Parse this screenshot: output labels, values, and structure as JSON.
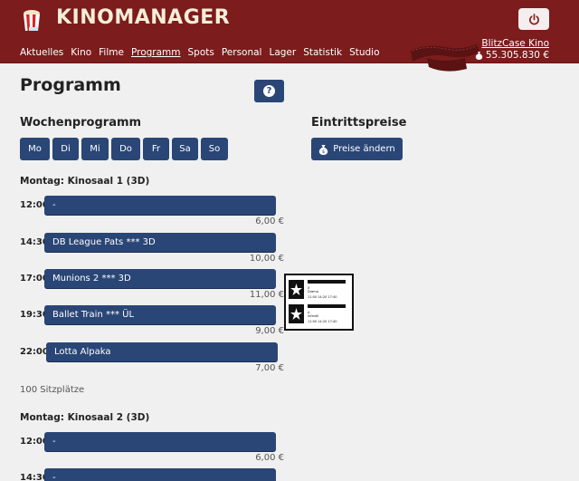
{
  "header": {
    "brand": "KINOMANAGER",
    "logo_icon": "popcorn-icon",
    "nav": [
      {
        "label": "Aktuelles",
        "active": false
      },
      {
        "label": "Kino",
        "active": false
      },
      {
        "label": "Filme",
        "active": false
      },
      {
        "label": "Programm",
        "active": true
      },
      {
        "label": "Spots",
        "active": false
      },
      {
        "label": "Personal",
        "active": false
      },
      {
        "label": "Lager",
        "active": false
      },
      {
        "label": "Statistik",
        "active": false
      },
      {
        "label": "Studio",
        "active": false
      }
    ],
    "power_icon": "power-icon",
    "account_name": "BlitzCase Kino",
    "balance": "55.305.830 €",
    "balance_icon": "money-bag-icon"
  },
  "colors": {
    "header_bg": "#7c1c1c",
    "button_bg": "#2a4676",
    "page_bg": "#f0f0f0"
  },
  "main": {
    "title": "Programm",
    "help_label": "?",
    "week_section": {
      "title": "Wochenprogramm",
      "days": [
        "Mo",
        "Di",
        "Mi",
        "Do",
        "Fr",
        "Sa",
        "So"
      ]
    },
    "prices_section": {
      "title": "Eintrittspreise",
      "button_label": "Preise ändern"
    },
    "halls": [
      {
        "title": "Montag: Kinosaal 1 (3D)",
        "slots": [
          {
            "time": "12:00",
            "movie": "-",
            "price": "6,00 €"
          },
          {
            "time": "14:30",
            "movie": "DB League Pats *** 3D",
            "price": "10,00 €"
          },
          {
            "time": "17:00",
            "movie": "Munions 2 *** 3D",
            "price": "11,00 €"
          },
          {
            "time": "19:30",
            "movie": "Ballet Train *** ÜL",
            "price": "9,00 €"
          },
          {
            "time": "22:00",
            "movie": "Lotta Alpaka",
            "price": "7,00 €"
          }
        ],
        "seats": "100 Sitzplätze"
      },
      {
        "title": "Montag: Kinosaal 2 (3D)",
        "slots": [
          {
            "time": "12:00",
            "movie": "-",
            "price": "6,00 €"
          },
          {
            "time": "14:30",
            "movie": "-",
            "price": ""
          }
        ]
      }
    ],
    "drag_card": {
      "entries": [
        {
          "rating": "0",
          "genre": "Drama",
          "times": "11:00 14:20 17:40"
        },
        {
          "rating": "A",
          "genre": "Infantil",
          "times": "11:00 14:20 17:40"
        }
      ]
    }
  }
}
